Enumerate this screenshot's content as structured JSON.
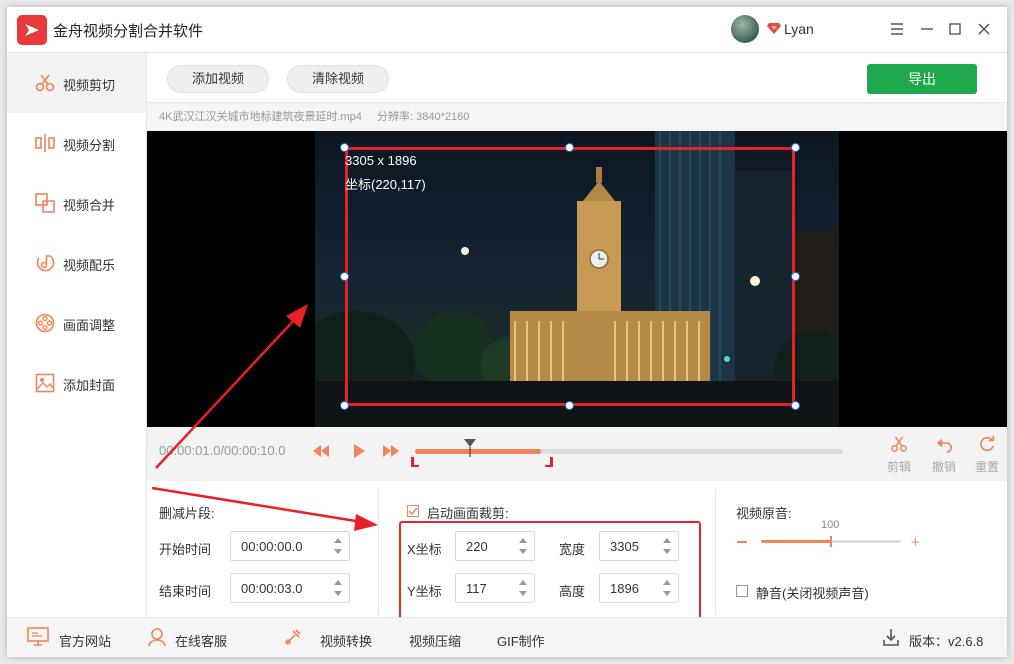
{
  "app": {
    "title": "金舟视频分割合并软件",
    "username": "Lyan"
  },
  "sidebar": {
    "items": [
      {
        "label": "视频剪切",
        "icon": "scissors-icon",
        "active": true
      },
      {
        "label": "视频分割",
        "icon": "split-icon"
      },
      {
        "label": "视频合并",
        "icon": "merge-icon"
      },
      {
        "label": "视频配乐",
        "icon": "music-note-icon"
      },
      {
        "label": "画面调整",
        "icon": "film-reel-icon"
      },
      {
        "label": "添加封面",
        "icon": "image-icon"
      }
    ]
  },
  "toolbar": {
    "add_video": "添加视频",
    "clear_video": "清除视频",
    "export": "导出"
  },
  "file": {
    "name": "4K武汉江汉关城市地标建筑夜景延时.mp4",
    "resolution": "分辨率: 3840*2160"
  },
  "crop_overlay": {
    "size_text": "3305 x 1896",
    "coord_text": "坐标(220,117)"
  },
  "timeline": {
    "timecode": "00:00:01.0/00:00:10.0",
    "tools": {
      "cut": "剪辑",
      "undo": "撤销",
      "reset": "重置"
    }
  },
  "trim": {
    "title": "删减片段:",
    "start_label": "开始时间",
    "start_value": "00:00:00.0",
    "end_label": "结束时间",
    "end_value": "00:00:03.0"
  },
  "crop": {
    "title": "启动画面裁剪:",
    "enabled": true,
    "x_label": "X坐标",
    "x_value": "220",
    "y_label": "Y坐标",
    "y_value": "117",
    "width_label": "宽度",
    "width_value": "3305",
    "height_label": "高度",
    "height_value": "1896"
  },
  "audio": {
    "title": "视频原音:",
    "volume": "100",
    "volume_fraction": 1.0,
    "mute_label": "静音(关闭视频声音)",
    "muted": false
  },
  "statusbar": {
    "website": "官方网站",
    "support": "在线客服",
    "convert": "视频转换",
    "compress": "视频压缩",
    "gif": "GIF制作",
    "version": "版本：v2.6.8"
  },
  "colors": {
    "accent": "#f0845a",
    "export_green": "#1fa84b",
    "highlight_red": "#e8202a",
    "logo_red": "#e83a3a"
  }
}
